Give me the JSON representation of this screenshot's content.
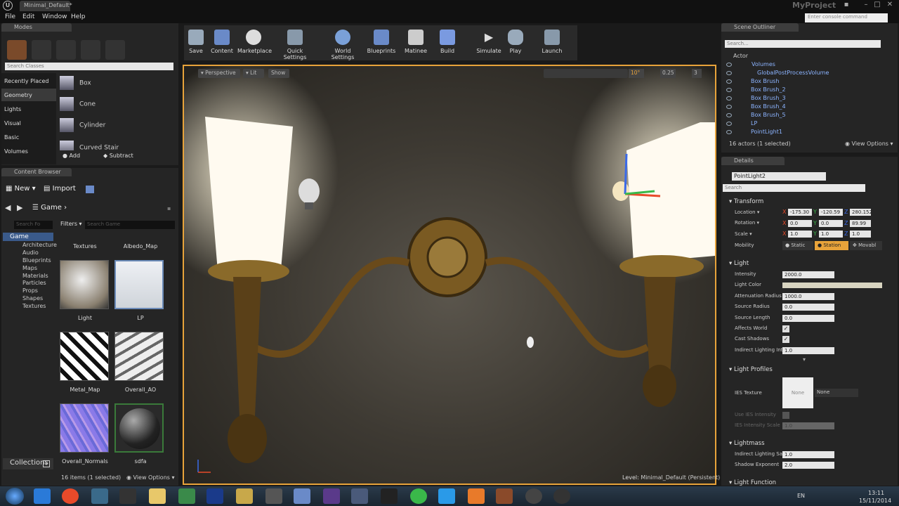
{
  "window": {
    "tab_title": "Minimal_Default*",
    "project": "MyProject",
    "console_placeholder": "Enter console command"
  },
  "menu": [
    "File",
    "Edit",
    "Window",
    "Help"
  ],
  "modes": {
    "title": "Modes",
    "search_placeholder": "Search Classes",
    "categories": [
      "Recently Placed",
      "Geometry",
      "Lights",
      "Visual",
      "Basic",
      "Volumes"
    ],
    "items": [
      "Box",
      "Cone",
      "Cylinder",
      "Curved Stair"
    ],
    "add_label": "Add",
    "subtract_label": "Subtract"
  },
  "toolbar": {
    "buttons": [
      "Save",
      "Content",
      "Marketplace",
      "Quick Settings",
      "World Settings",
      "Blueprints",
      "Matinee",
      "Build",
      "Simulate",
      "Play",
      "Launch"
    ]
  },
  "viewport": {
    "perspective": "Perspective",
    "lit": "Lit",
    "show": "Show",
    "angle": "10°",
    "scale": "0.25",
    "cam": "3",
    "level_label": "Level:",
    "level_name": "Minimal_Default (Persistent)"
  },
  "content_browser": {
    "title": "Content Browser",
    "new_label": "New",
    "import_label": "Import",
    "path": "Game",
    "search_folders": "Search Fo",
    "filters_label": "Filters",
    "search_placeholder": "Search Game",
    "tree": [
      "Game",
      "Architecture",
      "Audio",
      "Blueprints",
      "Maps",
      "Materials",
      "Particles",
      "Props",
      "Shapes",
      "Textures"
    ],
    "top_labels": [
      "Textures",
      "Albedo_Map"
    ],
    "assets": [
      "Light",
      "LP",
      "Metal_Map",
      "Overall_AO",
      "Overall_Normals",
      "sdfa"
    ],
    "collections_label": "Collections",
    "items_count": "16 items (1 selected)",
    "view_options": "View Options"
  },
  "outliner": {
    "title": "Scene Outliner",
    "search_placeholder": "Search...",
    "column": "Actor",
    "rows": [
      "Volumes",
      "GlobalPostProcessVolume",
      "Box Brush",
      "Box Brush_2",
      "Box Brush_3",
      "Box Brush_4",
      "Box Brush_5",
      "LP",
      "PointLight1"
    ],
    "count": "16 actors (1 selected)",
    "view_options": "View Options"
  },
  "details": {
    "title": "Details",
    "name": "PointLight2",
    "search_placeholder": "Search",
    "transform_label": "Transform",
    "location_label": "Location",
    "rotation_label": "Rotation",
    "scale_label": "Scale",
    "mobility_label": "Mobility",
    "location": [
      "-175.30",
      "-120.59",
      "280.152"
    ],
    "rotation": [
      "0.0",
      "0.0",
      "89.99"
    ],
    "scale": [
      "1.0",
      "1.0",
      "1.0"
    ],
    "axis": [
      "X",
      "Y",
      "Z"
    ],
    "mobility": [
      "Static",
      "Station",
      "Movabl"
    ],
    "light_label": "Light",
    "intensity_label": "Intensity",
    "intensity": "2000.0",
    "light_color_label": "Light Color",
    "atten_label": "Attenuation Radius",
    "atten": "1000.0",
    "src_radius_label": "Source Radius",
    "src_radius": "0.0",
    "src_length_label": "Source Length",
    "src_length": "0.0",
    "affects_label": "Affects World",
    "cast_label": "Cast Shadows",
    "indirect_label": "Indirect Lighting Int",
    "indirect": "1.0",
    "profiles_label": "Light Profiles",
    "ies_label": "IES Texture",
    "ies_thumb": "None",
    "ies_value": "None",
    "use_ies_label": "Use IES Intensity",
    "ies_scale_label": "IES Intensity Scale",
    "ies_scale": "1.0",
    "lightmass_label": "Lightmass",
    "lm_indirect_label": "Indirect Lighting Sa",
    "lm_indirect": "1.0",
    "shadow_exp_label": "Shadow Exponent",
    "shadow_exp": "2.0",
    "light_function_label": "Light Function"
  },
  "taskbar": {
    "lang": "EN",
    "time": "13:11",
    "date": "15/11/2014"
  },
  "colors": {
    "accent": "#e8a33a",
    "ue_blue": "#8cb4ff",
    "panel": "#252525"
  }
}
